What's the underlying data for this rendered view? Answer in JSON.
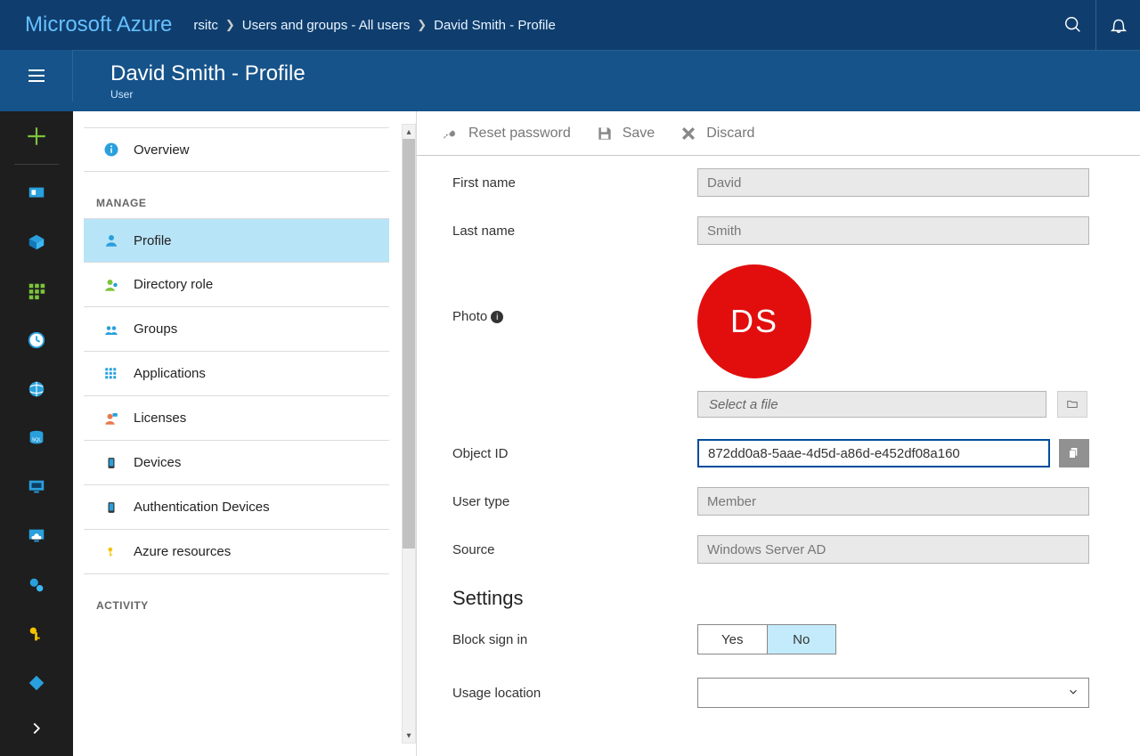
{
  "brand": "Microsoft Azure",
  "breadcrumb": {
    "root": "rsitc",
    "mid": "Users and groups - All users",
    "leaf": "David Smith - Profile"
  },
  "subheader": {
    "title": "David Smith - Profile",
    "subtitle": "User"
  },
  "toolbar": {
    "reset": "Reset password",
    "save": "Save",
    "discard": "Discard"
  },
  "nav": {
    "overview": "Overview",
    "manage": "MANAGE",
    "items": [
      {
        "label": "Profile"
      },
      {
        "label": "Directory role"
      },
      {
        "label": "Groups"
      },
      {
        "label": "Applications"
      },
      {
        "label": "Licenses"
      },
      {
        "label": "Devices"
      },
      {
        "label": "Authentication Devices"
      },
      {
        "label": "Azure resources"
      }
    ],
    "activity": "ACTIVITY"
  },
  "form": {
    "first_name_label": "First name",
    "first_name": "David",
    "last_name_label": "Last name",
    "last_name": "Smith",
    "photo_label": "Photo",
    "initials": "DS",
    "file_placeholder": "Select a file",
    "object_id_label": "Object ID",
    "object_id": "872dd0a8-5aae-4d5d-a86d-e452df08a160",
    "user_type_label": "User type",
    "user_type": "Member",
    "source_label": "Source",
    "source": "Windows Server AD",
    "settings_title": "Settings",
    "block_label": "Block sign in",
    "block_yes": "Yes",
    "block_no": "No",
    "usage_label": "Usage location"
  }
}
